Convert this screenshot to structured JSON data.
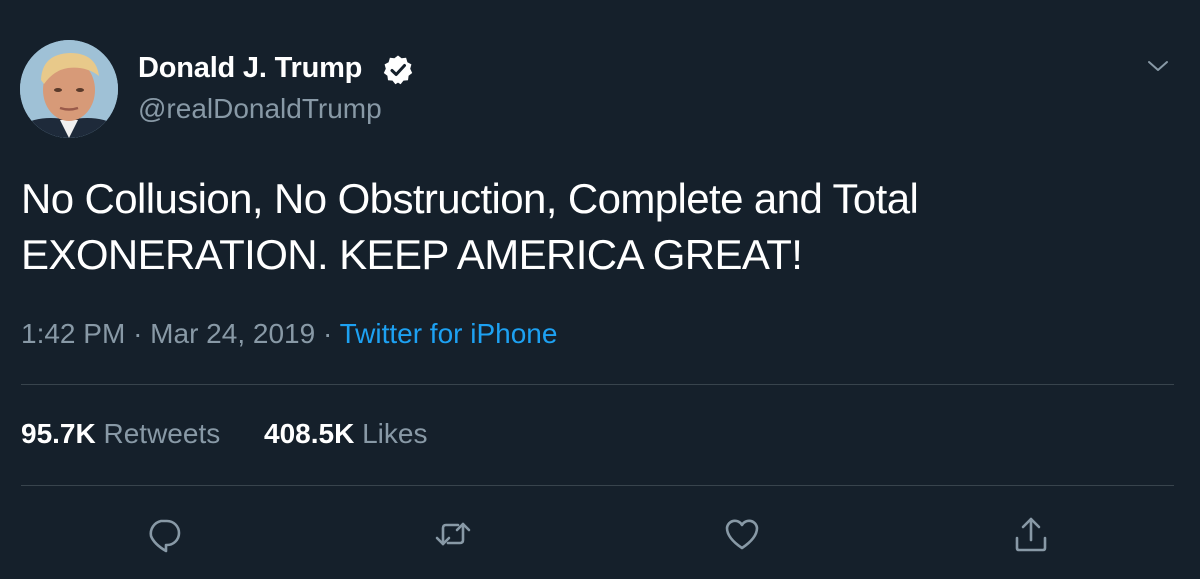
{
  "tweet": {
    "author": {
      "display_name": "Donald J. Trump",
      "handle": "@realDonaldTrump",
      "verified_icon": "verified-badge-icon"
    },
    "text_line_1": "No Collusion, No Obstruction, Complete and Total",
    "text_line_2": "EXONERATION. KEEP AMERICA GREAT!",
    "time": "1:42 PM",
    "separator": "·",
    "date": "Mar 24, 2019",
    "source": "Twitter for iPhone",
    "stats": {
      "retweets_count": "95.7K",
      "retweets_label": "Retweets",
      "likes_count": "408.5K",
      "likes_label": "Likes"
    },
    "actions": [
      "reply-icon",
      "retweet-icon",
      "like-icon",
      "share-icon"
    ]
  },
  "colors": {
    "background": "#15202b",
    "primary_text": "#ffffff",
    "secondary_text": "#8899a6",
    "accent": "#1da1f2",
    "divider": "#38444d"
  }
}
